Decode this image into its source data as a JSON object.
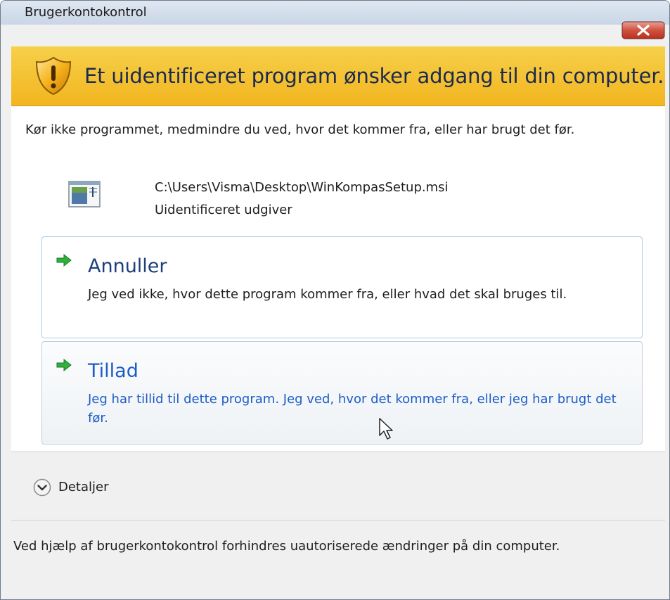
{
  "window": {
    "title": "Brugerkontokontrol"
  },
  "banner": {
    "message": "Et uidentificeret program ønsker adgang til din computer."
  },
  "warning": {
    "text": "Kør ikke programmet, medmindre du ved, hvor det kommer fra, eller har brugt det før."
  },
  "program": {
    "path": "C:\\Users\\Visma\\Desktop\\WinKompasSetup.msi",
    "publisher": "Uidentificeret udgiver"
  },
  "options": {
    "cancel": {
      "title": "Annuller",
      "description": "Jeg ved ikke, hvor dette program kommer fra, eller hvad det skal bruges til."
    },
    "allow": {
      "title": "Tillad",
      "description": "Jeg har tillid til dette program. Jeg ved, hvor det kommer fra, eller jeg har brugt det før."
    }
  },
  "details": {
    "label": "Detaljer"
  },
  "footer": {
    "text": "Ved hjælp af brugerkontokontrol forhindres uautoriserede ændringer på din computer."
  },
  "icons": {
    "close": "close-icon",
    "shield": "shield-warning-icon",
    "program": "program-icon",
    "arrow": "green-arrow-icon",
    "expand": "chevron-down-icon"
  },
  "colors": {
    "banner": "#f2b51f",
    "option_title": "#1c3f7a",
    "option_allow_text": "#1c5cc8",
    "close_button": "#c9463d"
  }
}
